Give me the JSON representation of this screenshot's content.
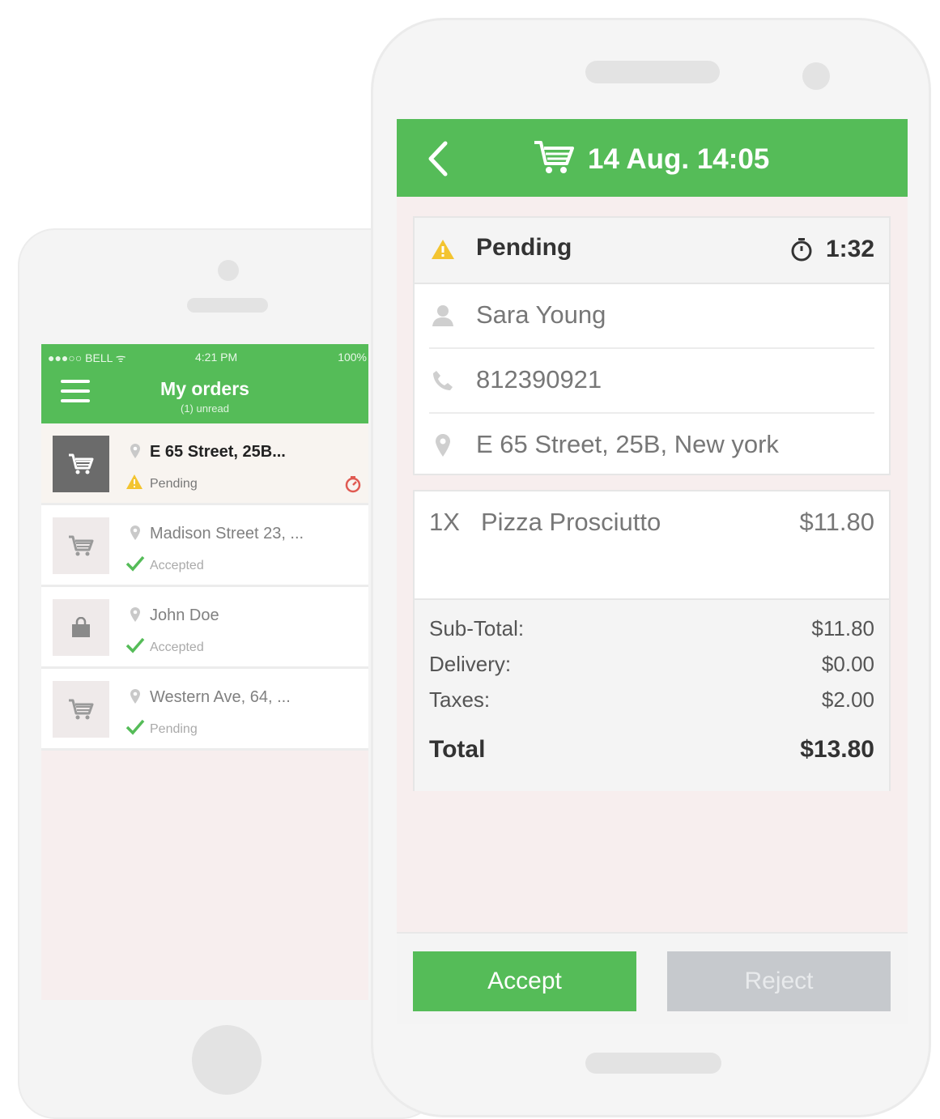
{
  "colors": {
    "accent": "#55bc58",
    "warning": "#f3c430",
    "danger": "#e05a52",
    "reject": "#c6c9cd"
  },
  "ios": {
    "status_bar": {
      "carrier": "●●●○○ BELL ᯤ",
      "time": "4:21 PM",
      "battery": "100%"
    },
    "header": {
      "title": "My orders",
      "subtitle": "(1) unread"
    },
    "orders": [
      {
        "address": "E 65 Street, 25B...",
        "status": "Pending",
        "icon": "cart-icon",
        "status_icon": "warning-icon",
        "active": true
      },
      {
        "address": "Madison Street 23, ...",
        "status": "Accepted",
        "icon": "cart-icon",
        "status_icon": "check-icon",
        "active": false
      },
      {
        "address": "John Doe",
        "status": "Accepted",
        "icon": "bag-icon",
        "status_icon": "check-icon",
        "active": false
      },
      {
        "address": "Western Ave, 64, ...",
        "status": "Pending",
        "icon": "cart-icon",
        "status_icon": "check-icon",
        "active": false
      }
    ]
  },
  "detail": {
    "header": {
      "title": "14 Aug. 14:05"
    },
    "status": {
      "label": "Pending",
      "timer": "1:32"
    },
    "customer": {
      "name": "Sara Young",
      "phone": "812390921",
      "address": "E 65 Street, 25B, New york"
    },
    "items": [
      {
        "qty": "1X",
        "name": "Pizza Prosciutto",
        "price": "$11.80"
      }
    ],
    "totals": {
      "subtotal_label": "Sub-Total:",
      "subtotal": "$11.80",
      "delivery_label": "Delivery:",
      "delivery": "$0.00",
      "taxes_label": "Taxes:",
      "taxes": "$2.00",
      "total_label": "Total",
      "total": "$13.80"
    },
    "actions": {
      "accept": "Accept",
      "reject": "Reject"
    }
  }
}
